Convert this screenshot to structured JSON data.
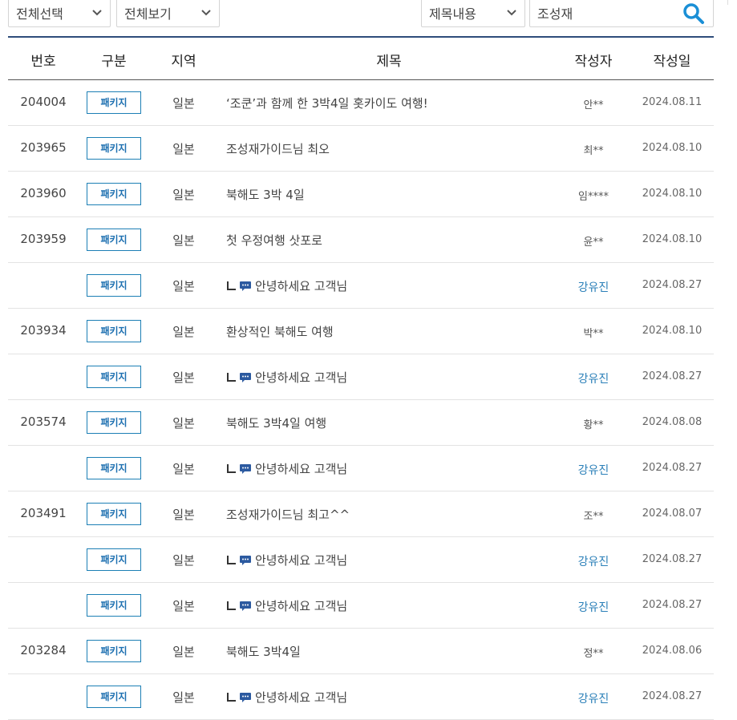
{
  "filters": {
    "select1": "전체선택",
    "select2": "전체보기",
    "field_select": "제목내용",
    "search_value": "조성재"
  },
  "table": {
    "headers": [
      "번호",
      "구분",
      "지역",
      "제목",
      "작성자",
      "작성일"
    ],
    "rows": [
      {
        "num": "204004",
        "type": "패키지",
        "region": "일본",
        "title": "‘조쿤’과 함께 한 3박4일 홋카이도 여행!",
        "author": "안**",
        "date": "2024.08.11",
        "reply": false
      },
      {
        "num": "203965",
        "type": "패키지",
        "region": "일본",
        "title": "조성재가이드님 최오",
        "author": "최**",
        "date": "2024.08.10",
        "reply": false
      },
      {
        "num": "203960",
        "type": "패키지",
        "region": "일본",
        "title": "북해도 3박 4일",
        "author": "임****",
        "date": "2024.08.10",
        "reply": false
      },
      {
        "num": "203959",
        "type": "패키지",
        "region": "일본",
        "title": "첫 우정여행 삿포로",
        "author": "윤**",
        "date": "2024.08.10",
        "reply": false
      },
      {
        "num": "",
        "type": "패키지",
        "region": "일본",
        "title": "안녕하세요 고객님",
        "author": "강유진",
        "date": "2024.08.27",
        "reply": true
      },
      {
        "num": "203934",
        "type": "패키지",
        "region": "일본",
        "title": "환상적인 북해도 여행",
        "author": "박**",
        "date": "2024.08.10",
        "reply": false
      },
      {
        "num": "",
        "type": "패키지",
        "region": "일본",
        "title": "안녕하세요 고객님",
        "author": "강유진",
        "date": "2024.08.27",
        "reply": true
      },
      {
        "num": "203574",
        "type": "패키지",
        "region": "일본",
        "title": "북해도 3박4일 여행",
        "author": "황**",
        "date": "2024.08.08",
        "reply": false
      },
      {
        "num": "",
        "type": "패키지",
        "region": "일본",
        "title": "안녕하세요 고객님",
        "author": "강유진",
        "date": "2024.08.27",
        "reply": true
      },
      {
        "num": "203491",
        "type": "패키지",
        "region": "일본",
        "title": "조성재가이드님 최고^^",
        "author": "조**",
        "date": "2024.08.07",
        "reply": false
      },
      {
        "num": "",
        "type": "패키지",
        "region": "일본",
        "title": "안녕하세요 고객님",
        "author": "강유진",
        "date": "2024.08.27",
        "reply": true
      },
      {
        "num": "",
        "type": "패키지",
        "region": "일본",
        "title": "안녕하세요 고객님",
        "author": "강유진",
        "date": "2024.08.27",
        "reply": true
      },
      {
        "num": "203284",
        "type": "패키지",
        "region": "일본",
        "title": "북해도 3박4일",
        "author": "정**",
        "date": "2024.08.06",
        "reply": false
      },
      {
        "num": "",
        "type": "패키지",
        "region": "일본",
        "title": "안녕하세요 고객님",
        "author": "강유진",
        "date": "2024.08.27",
        "reply": true
      }
    ]
  },
  "colors": {
    "accent_blue": "#1c7fb5",
    "header_rule": "#2e4d7b",
    "staff_author": "#2a7fb8",
    "reply_icon": "#2c5aa0"
  },
  "icons": {
    "search": "search-icon",
    "chevron": "chevron-down-icon",
    "reply": "reply-arrow-icon",
    "comment": "comment-bubble-icon"
  }
}
